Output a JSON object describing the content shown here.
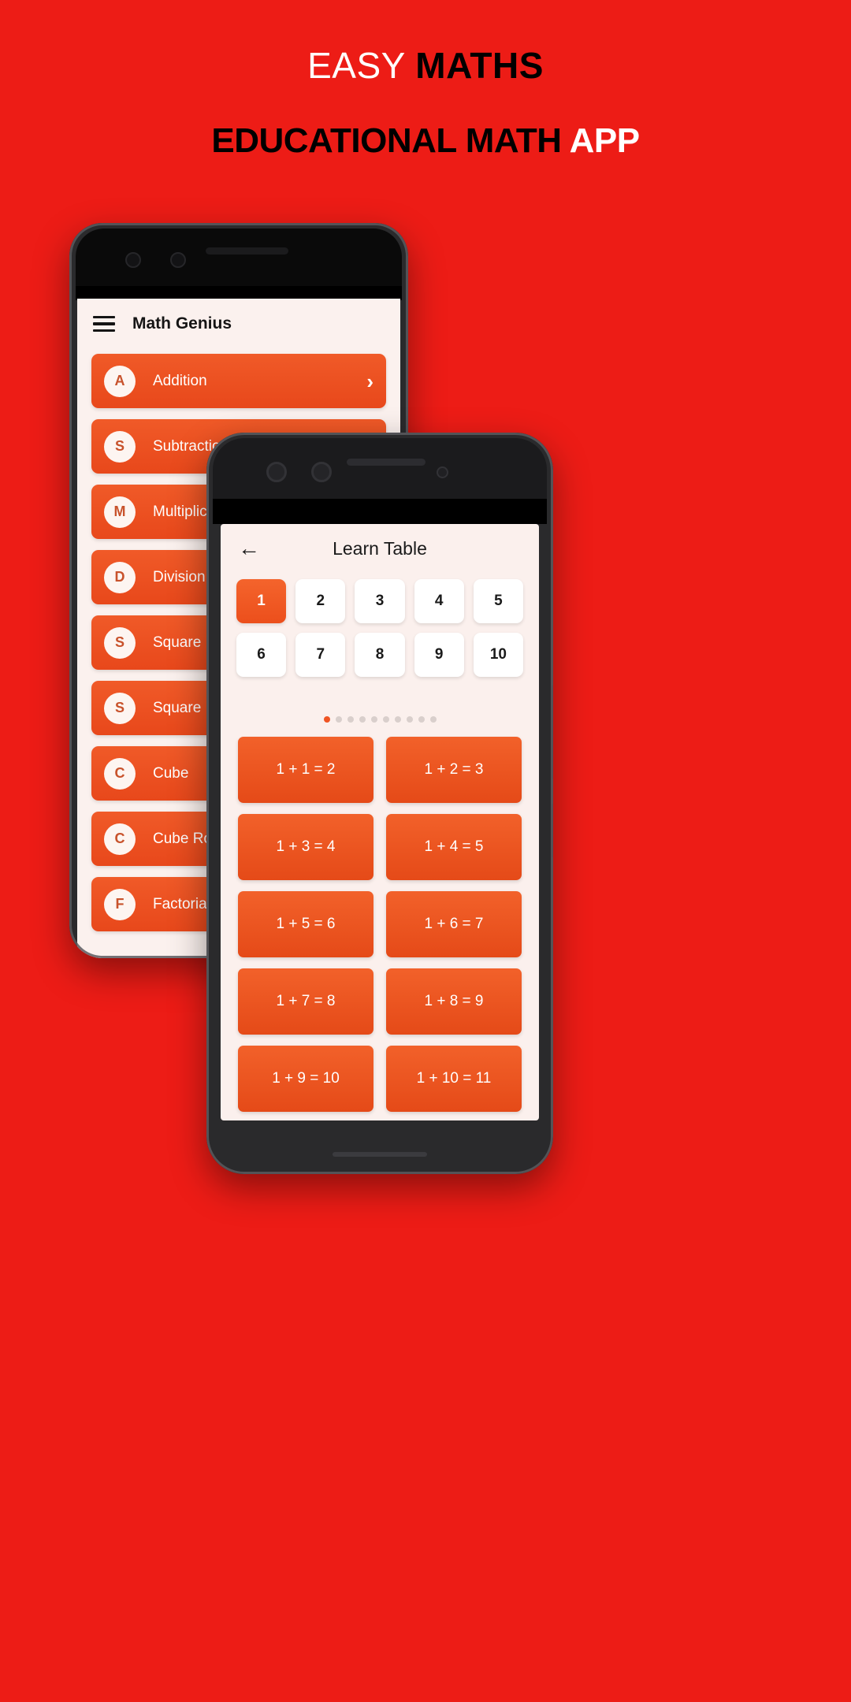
{
  "banner": {
    "background_color": "#ED1C16",
    "title_part1": "EASY ",
    "title_part2": "MATHS",
    "subtitle_part1": "EDUCATIONAL MATH ",
    "subtitle_part2": "APP"
  },
  "back_phone": {
    "app_bar": {
      "menu_icon": "hamburger-icon",
      "title": "Math Genius"
    },
    "list": [
      {
        "initial": "A",
        "label": "Addition",
        "chevron": "›"
      },
      {
        "initial": "S",
        "label": "Subtraction",
        "chevron": "›"
      },
      {
        "initial": "M",
        "label": "Multiplication",
        "chevron": "›"
      },
      {
        "initial": "D",
        "label": "Division",
        "chevron": "›"
      },
      {
        "initial": "S",
        "label": "Square",
        "chevron": "›"
      },
      {
        "initial": "S",
        "label": "Square Root",
        "chevron": "›"
      },
      {
        "initial": "C",
        "label": "Cube",
        "chevron": "›"
      },
      {
        "initial": "C",
        "label": "Cube Root",
        "chevron": "›"
      },
      {
        "initial": "F",
        "label": "Factorial",
        "chevron": "›"
      }
    ]
  },
  "front_phone": {
    "app_bar": {
      "back_icon": "←",
      "title": "Learn Table"
    },
    "number_selector": {
      "numbers": [
        "1",
        "2",
        "3",
        "4",
        "5",
        "6",
        "7",
        "8",
        "9",
        "10"
      ],
      "selected": "1"
    },
    "pagination": {
      "total": 10,
      "active_index": 0
    },
    "facts": [
      "1 + 1 = 2",
      "1 + 2 = 3",
      "1 + 3 = 4",
      "1 + 4 = 5",
      "1 + 5 = 6",
      "1 + 6 = 7",
      "1 + 7 = 8",
      "1 + 8 = 9",
      "1 + 9 = 10",
      "1 + 10 = 11"
    ]
  },
  "colors": {
    "brand_red": "#ED1C16",
    "accent_orange": "#EF5423",
    "screen_bg": "#FBF0ED",
    "text_dark": "#1a1a1a"
  }
}
